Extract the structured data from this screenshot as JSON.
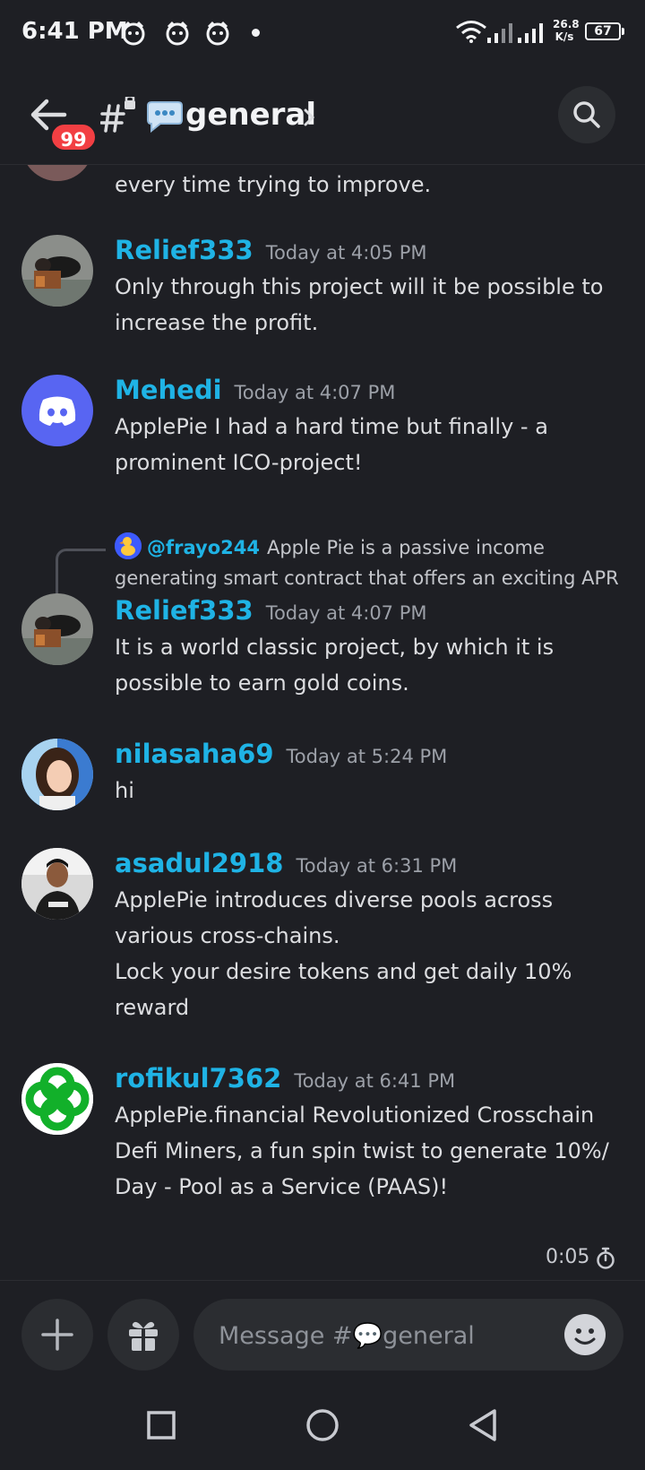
{
  "status_bar": {
    "time": "6:41 PM",
    "notification_icons": [
      "app-notification-icon",
      "app-notification-icon",
      "app-notification-icon"
    ],
    "net_speed_value": "26.8",
    "net_speed_unit": "K/s",
    "battery": "67"
  },
  "header": {
    "unread_badge": "99",
    "channel_emoji": "💬",
    "channel_name": "general"
  },
  "messages": [
    {
      "text_partial": "every time trying to improve."
    },
    {
      "author": "Relief333",
      "timestamp": "Today at 4:05 PM",
      "text": "Only through this project will it be possible to increase the profit."
    },
    {
      "author": "Mehedi",
      "timestamp": "Today at 4:07 PM",
      "text": "ApplePie I had a hard time but finally - a prominent ICO-project!"
    },
    {
      "reply_to": {
        "author": "@frayo244",
        "text": "Apple Pie is a passive income generating smart contract that offers an exciting APR"
      },
      "author": "Relief333",
      "timestamp": "Today at 4:07 PM",
      "text": "It is a world classic project, by which it is possible to earn gold coins."
    },
    {
      "author": "nilasaha69",
      "timestamp": "Today at 5:24 PM",
      "text": "hi"
    },
    {
      "author": "asadul2918",
      "timestamp": "Today at 6:31 PM",
      "text_line1": "ApplePie introduces diverse pools across various cross-chains.",
      "text_line2": "Lock your desire tokens and get daily 10% reward"
    },
    {
      "author": "rofikul7362",
      "timestamp": "Today at 6:41 PM",
      "text": "ApplePie.financial Revolutionized Crosschain Defi Miners, a fun spin twist to generate 10%/ Day - Pool as a Service (PAAS)!"
    }
  ],
  "slowmode_timer": "0:05",
  "composer": {
    "placeholder": "Message #💬general"
  },
  "colors": {
    "background": "#1e1f24",
    "author": "#1fb3e5",
    "badge": "#f23f43",
    "discord_blurple": "#5865f2"
  }
}
